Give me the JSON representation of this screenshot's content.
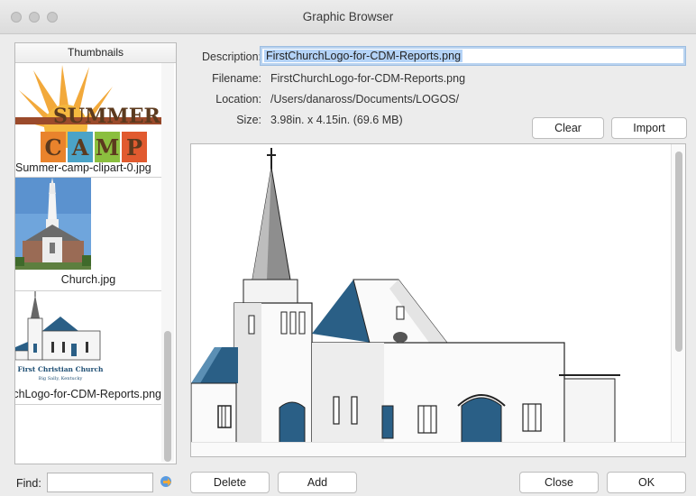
{
  "window": {
    "title": "Graphic Browser"
  },
  "thumbnails": {
    "header": "Thumbnails",
    "items": [
      {
        "label": "Summer-camp-clipart-0.jpg",
        "image": "summer-camp-logo"
      },
      {
        "label": "Church.jpg",
        "image": "church-photo"
      },
      {
        "label": "FirstChurchLogo-for-CDM-Reports.png",
        "image": "first-christian-church-logo",
        "selected": true
      }
    ],
    "summer_text": "SUMMER",
    "camp_letters": [
      "C",
      "A",
      "M",
      "P"
    ],
    "church_logo_line1": "First Christian Church",
    "church_logo_line2": "Big Sally, Kentucky"
  },
  "info": {
    "description_label": "Description:",
    "description_value": "FirstChurchLogo-for-CDM-Reports.png",
    "filename_label": "Filename:",
    "filename_value": "FirstChurchLogo-for-CDM-Reports.png",
    "location_label": "Location:",
    "location_value": "/Users/danaross/Documents/LOGOS/",
    "size_label": "Size:",
    "size_value": "3.98in. x 4.15in. (69.6 MB)"
  },
  "buttons": {
    "clear": "Clear",
    "import": "Import",
    "delete": "Delete",
    "add": "Add",
    "close": "Close",
    "ok": "OK"
  },
  "find": {
    "label": "Find:",
    "value": ""
  },
  "colors": {
    "selection": "#b4d3f7",
    "church_blue": "#2a5f86",
    "church_gray": "#8e8e8e"
  }
}
